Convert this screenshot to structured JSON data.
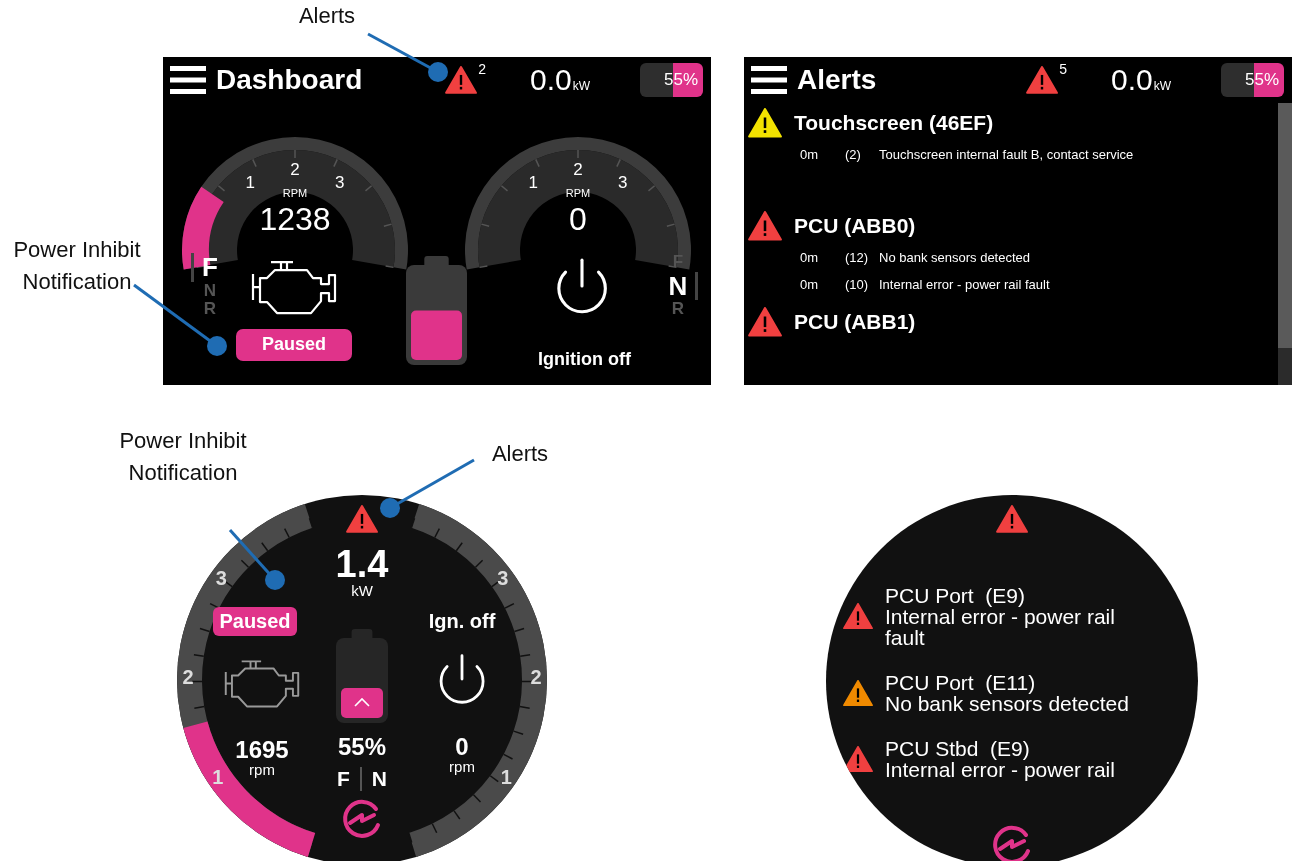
{
  "annotations": [
    {
      "text": "Alerts"
    },
    {
      "text": "Power Inhibit Notification"
    },
    {
      "text": "Power Inhibit Notification"
    },
    {
      "text": "Alerts"
    }
  ],
  "dashboard": {
    "title": "Dashboard",
    "alert_count": "2",
    "power": "0.0",
    "power_unit": "kW",
    "battery": "55%",
    "gauges": [
      {
        "scale": [
          "1",
          "2",
          "3"
        ],
        "label": "RPM",
        "value": "1238",
        "level": 0.22
      },
      {
        "scale": [
          "1",
          "2",
          "3"
        ],
        "label": "RPM",
        "value": "0"
      }
    ],
    "gears_left": [
      {
        "label": "F",
        "selected": true
      },
      {
        "label": "N",
        "selected": false
      },
      {
        "label": "R",
        "selected": false
      }
    ],
    "gears_right": [
      {
        "label": "F",
        "selected": false
      },
      {
        "label": "N",
        "selected": true
      },
      {
        "label": "R",
        "selected": false
      }
    ],
    "status": "Paused",
    "battery_gauge": {
      "level": 0.55
    },
    "ignition": "Ignition off"
  },
  "alerts": {
    "title": "Alerts",
    "alert_count": "5",
    "power": "0.0",
    "power_unit": "kW",
    "battery": "55%",
    "groups": [
      {
        "color": "#f2e200",
        "title": "Touchscreen (46EF)",
        "entries": [
          {
            "time": "0m",
            "code": "(2)",
            "message": "Touchscreen internal fault B, contact service"
          }
        ]
      },
      {
        "color": "#f04040",
        "title": "PCU (ABB0)",
        "entries": [
          {
            "time": "0m",
            "code": "(12)",
            "message": "No bank sensors detected"
          },
          {
            "time": "0m",
            "code": "(10)",
            "message": "Internal error - power rail fault"
          }
        ]
      },
      {
        "color": "#f04040",
        "title": "PCU (ABB1)"
      }
    ]
  },
  "round_gauge": {
    "power": "1.4",
    "power_unit": "kW",
    "status": "Paused",
    "ignition": "Ign. off",
    "rings": [
      {
        "scale": [
          "1",
          "2",
          "3"
        ],
        "level": 0.4
      },
      {
        "scale": [
          "1",
          "2",
          "3"
        ]
      }
    ],
    "left_rpm": {
      "value": "1695",
      "unit": "rpm"
    },
    "battery": {
      "reading": "55%",
      "level": 0.4
    },
    "right_rpm": {
      "value": "0",
      "unit": "rpm"
    },
    "gears": [
      "F",
      "N"
    ]
  },
  "round_alerts": {
    "items": [
      {
        "color": "#f04040",
        "source": "PCU Port  (E9)",
        "message": "Internal error - power rail fault"
      },
      {
        "color": "#f08a00",
        "source": "PCU Port  (E11)",
        "message": "No bank sensors detected"
      },
      {
        "color": "#f04040",
        "source": "PCU Stbd  (E9)",
        "message": "Internal error - power rail"
      }
    ]
  }
}
